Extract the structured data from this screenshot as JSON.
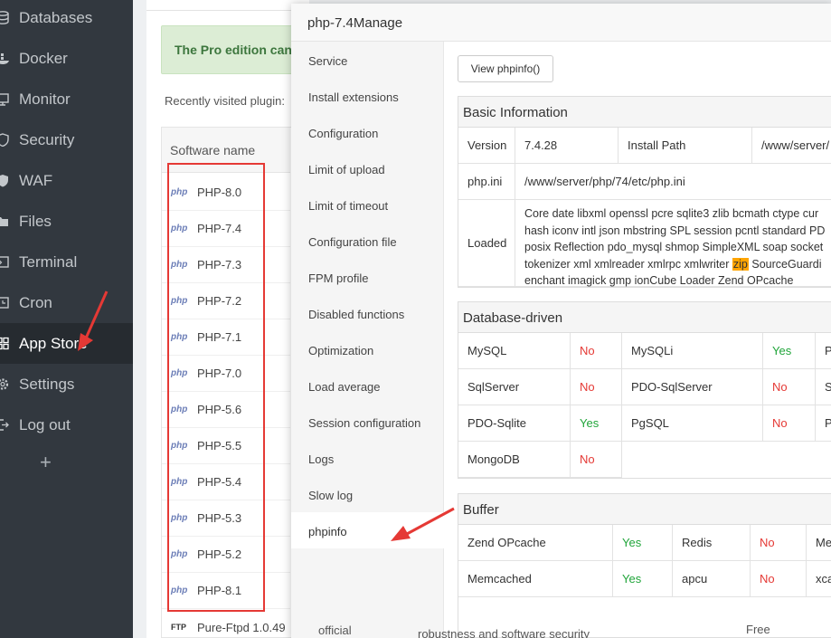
{
  "nav": {
    "items": [
      {
        "label": "Databases",
        "icon": "database-icon"
      },
      {
        "label": "Docker",
        "icon": "docker-icon"
      },
      {
        "label": "Monitor",
        "icon": "monitor-icon"
      },
      {
        "label": "Security",
        "icon": "shield-icon"
      },
      {
        "label": "WAF",
        "icon": "waf-icon"
      },
      {
        "label": "Files",
        "icon": "folder-icon"
      },
      {
        "label": "Terminal",
        "icon": "terminal-icon"
      },
      {
        "label": "Cron",
        "icon": "clock-icon"
      },
      {
        "label": "App Store",
        "icon": "grid-icon",
        "active": true
      },
      {
        "label": "Settings",
        "icon": "gear-icon"
      },
      {
        "label": "Log out",
        "icon": "logout-icon"
      }
    ],
    "plus": "+"
  },
  "background": {
    "pro_alert": "The Pro edition can",
    "recent_label": "Recently visited plugin:",
    "table_header": "Software name",
    "php_logo": "php",
    "rows": [
      "PHP-8.0",
      "PHP-7.4",
      "PHP-7.3",
      "PHP-7.2",
      "PHP-7.1",
      "PHP-7.0",
      "PHP-5.6",
      "PHP-5.5",
      "PHP-5.4",
      "PHP-5.3",
      "PHP-5.2",
      "PHP-8.1"
    ],
    "ftp_logo": "FTP",
    "ftp_name": "Pure-Ftpd 1.0.49",
    "official": "official",
    "free": "Free",
    "bottom_text": "robustness and software security"
  },
  "modal": {
    "title": "php-7.4Manage",
    "menu": [
      "Service",
      "Install extensions",
      "Configuration",
      "Limit of upload",
      "Limit of timeout",
      "Configuration file",
      "FPM profile",
      "Disabled functions",
      "Optimization",
      "Load average",
      "Session configuration",
      "Logs",
      "Slow log",
      "phpinfo"
    ],
    "active_menu": "phpinfo",
    "view_button": "View phpinfo()",
    "basic": {
      "heading": "Basic Information",
      "version_label": "Version",
      "version_value": "7.4.28",
      "install_path_label": "Install Path",
      "install_path_value": "/www/server/",
      "phpini_label": "php.ini",
      "phpini_value": "/www/server/php/74/etc/php.ini",
      "loaded_label": "Loaded",
      "loaded_line1": "Core date libxml openssl pcre sqlite3 zlib bcmath ctype cur",
      "loaded_line2": "hash iconv intl json mbstring SPL session pcntl standard PD",
      "loaded_line3": "posix Reflection pdo_mysql shmop SimpleXML soap socket",
      "loaded_line4a": "tokenizer xml xmlreader xmlrpc xmlwriter ",
      "loaded_line4_mark": "zip",
      "loaded_line4b": " SourceGuardi",
      "loaded_line5": "enchant imagick gmp ionCube Loader Zend OPcache"
    },
    "database": {
      "heading": "Database-driven",
      "mysql": "MySQL",
      "mysql_v": "No",
      "mysqli": "MySQLi",
      "mysqli_v": "Yes",
      "r1_c5": "P",
      "sqlserver": "SqlServer",
      "sqlserver_v": "No",
      "pdo_sqlserver": "PDO-SqlServer",
      "pdo_sqlserver_v": "No",
      "r2_c5": "S",
      "pdo_sqlite": "PDO-Sqlite",
      "pdo_sqlite_v": "Yes",
      "pgsql": "PgSQL",
      "pgsql_v": "No",
      "r3_c5": "P",
      "mongodb": "MongoDB",
      "mongodb_v": "No"
    },
    "buffer": {
      "heading": "Buffer",
      "opcache": "Zend OPcache",
      "opcache_v": "Yes",
      "redis": "Redis",
      "redis_v": "No",
      "r1_c5": "Me",
      "memcached": "Memcached",
      "memcached_v": "Yes",
      "apcu": "apcu",
      "apcu_v": "No",
      "r2_c5": "xca"
    }
  },
  "colors": {
    "accent_red": "#e53935",
    "yes_green": "#20a53a",
    "sidebar": "#32383f",
    "highlight": "#ffa500"
  }
}
